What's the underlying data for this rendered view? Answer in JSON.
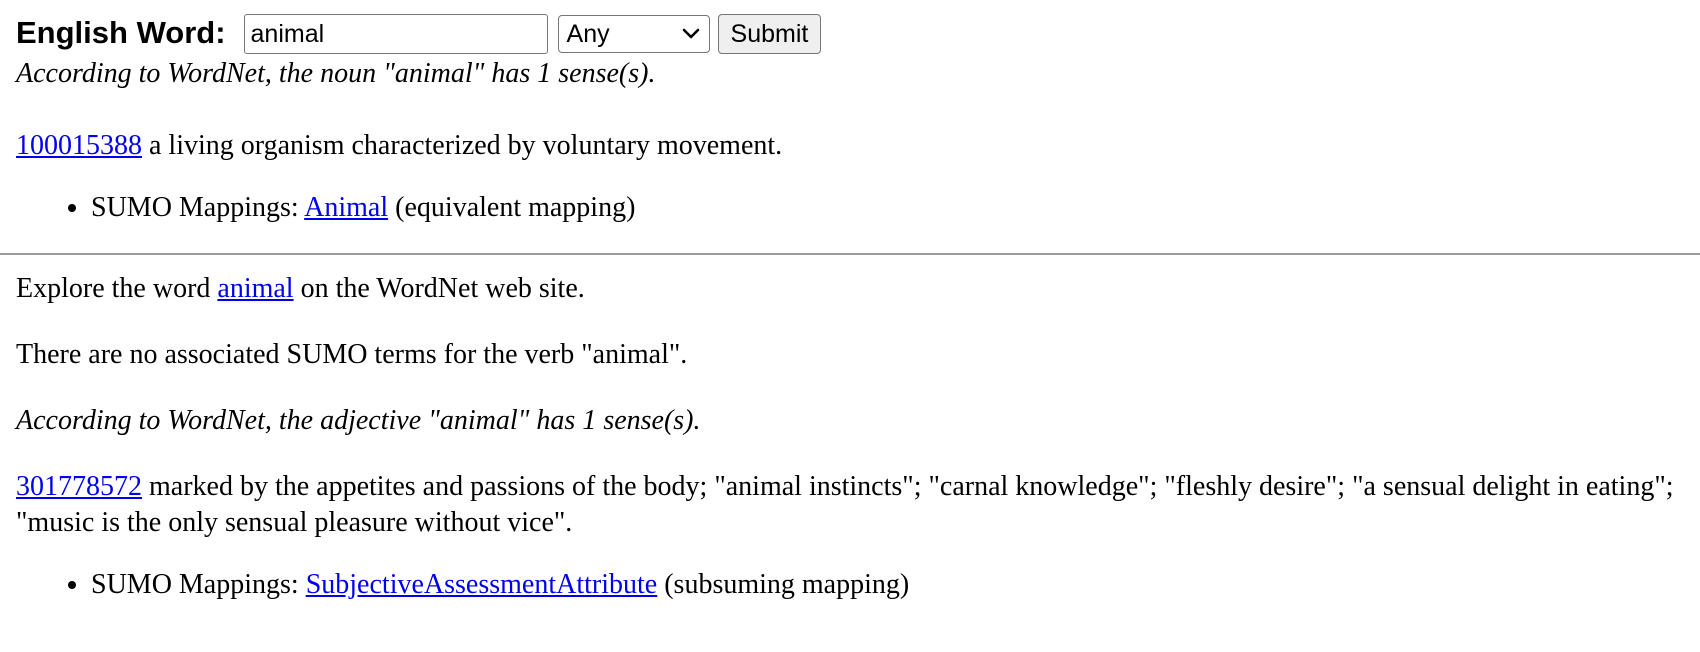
{
  "form": {
    "label": "English Word:",
    "word_value": "animal",
    "pos_selected": "Any",
    "submit_label": "Submit"
  },
  "noun": {
    "header_prefix": "According to WordNet, the noun \"animal\" has 1 sense(s).",
    "sense_id": "100015388",
    "gloss": " a living organism characterized by voluntary movement.",
    "mapping_label": "SUMO Mappings: ",
    "mapping_term": "Animal",
    "mapping_type": " (equivalent mapping)"
  },
  "explore": {
    "prefix": "Explore the word ",
    "word_link": "animal",
    "suffix": " on the WordNet web site."
  },
  "verb": {
    "message": "There are no associated SUMO terms for the verb \"animal\"."
  },
  "adjective": {
    "header": "According to WordNet, the adjective \"animal\" has 1 sense(s).",
    "sense_id": "301778572",
    "gloss": " marked by the appetites and passions of the body; \"animal instincts\"; \"carnal knowledge\"; \"fleshly desire\"; \"a sensual delight in eating\"; \"music is the only sensual pleasure without vice\".",
    "mapping_label": "SUMO Mappings: ",
    "mapping_term": "SubjectiveAssessmentAttribute",
    "mapping_type": " (subsuming mapping)"
  },
  "colors": {
    "link": "#0000ee",
    "divider": "#9a9a9a"
  }
}
